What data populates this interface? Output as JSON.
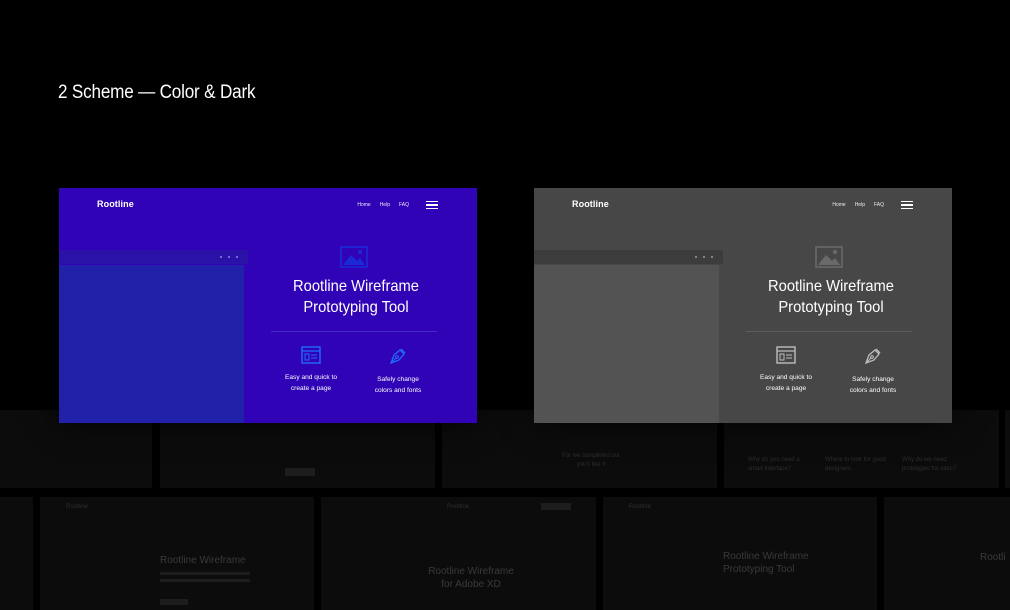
{
  "page": {
    "title": "2 Scheme — Color & Dark"
  },
  "cards": [
    {
      "scheme": "color",
      "accent": "#3004b6",
      "logo": "Rootline",
      "nav": [
        "Home",
        "Help",
        "FAQ"
      ],
      "hero_title": "Rootline Wireframe Prototyping Tool",
      "features": [
        {
          "icon": "layout-icon",
          "label": "Easy and quick to\ncreate a page"
        },
        {
          "icon": "pen-tool-icon",
          "label": "Safely change\ncolors and fonts"
        }
      ]
    },
    {
      "scheme": "dark",
      "accent": "#474747",
      "logo": "Rootline",
      "nav": [
        "Home",
        "Help",
        "FAQ"
      ],
      "hero_title": "Rootline Wireframe Prototyping Tool",
      "features": [
        {
          "icon": "layout-icon",
          "label": "Easy and quick to\ncreate a page"
        },
        {
          "icon": "pen-tool-icon",
          "label": "Safely change\ncolors and fonts"
        }
      ]
    }
  ],
  "background_thumbnails": {
    "row1": [
      "For we completed our\nyou'll like it",
      "Why do you need a\nsmart interface?",
      "Where to look for good\ndesigners",
      "Why do we need\nprototypes for sites?"
    ],
    "row2": [
      "Rootline Wireframe",
      "Rootline Wireframe\nfor Adobe XD",
      "Rootline Wireframe\nPrototyping Tool",
      "Rootli"
    ],
    "logos": [
      "Rootline",
      "Rootline",
      "Rootline"
    ]
  }
}
